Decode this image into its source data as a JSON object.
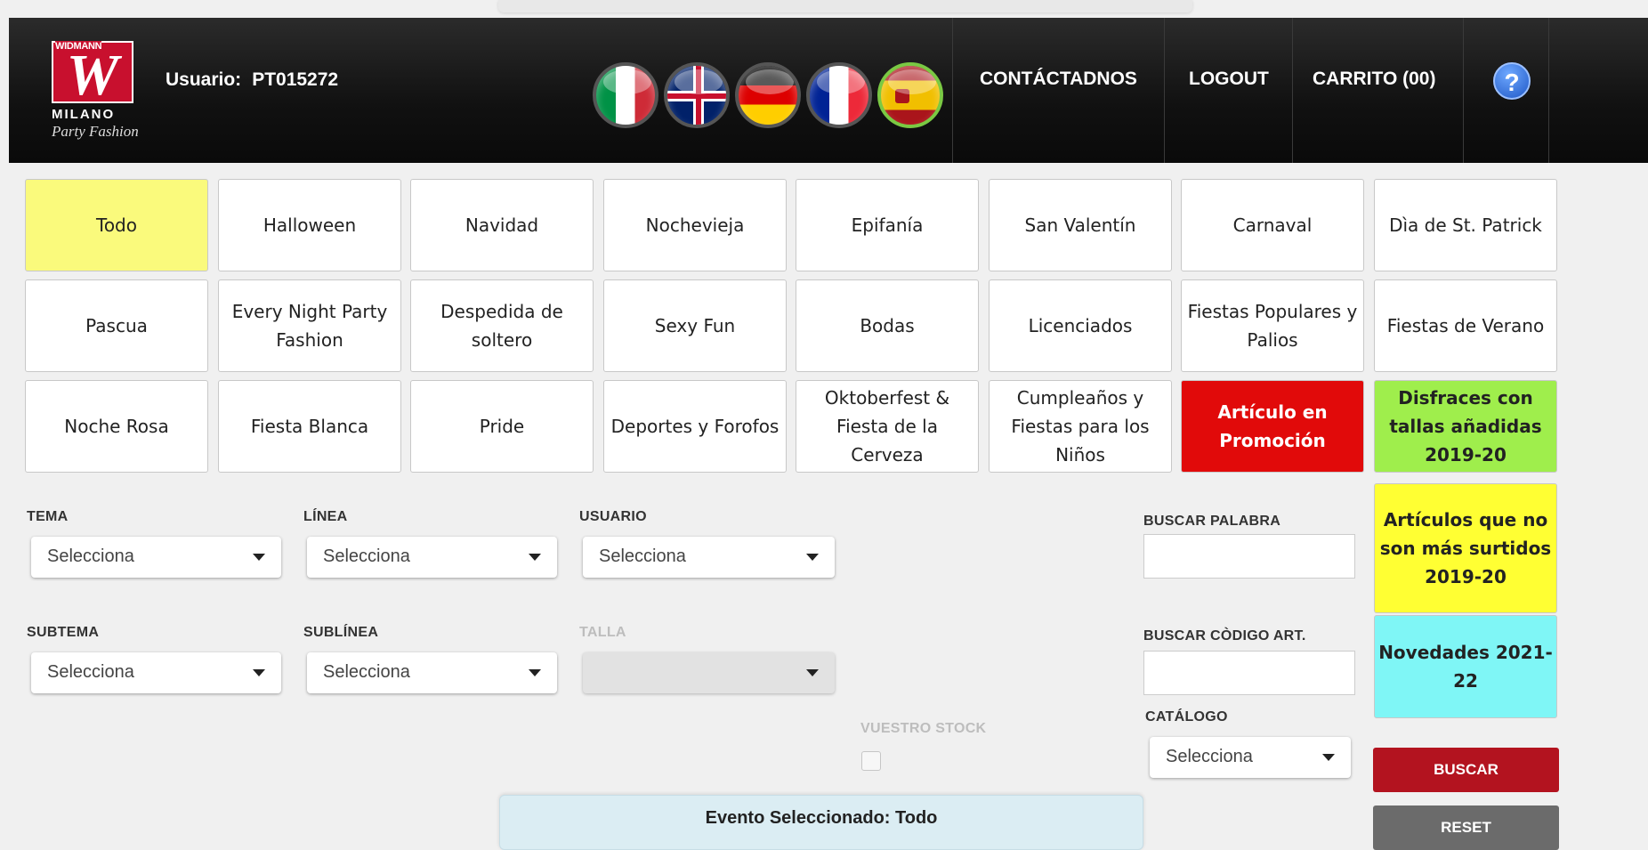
{
  "header": {
    "brand": {
      "top": "WIDMANN",
      "mark": "W",
      "city": "MILANO",
      "tagline": "Party Fashion"
    },
    "user_label": "Usuario:",
    "user_value": "PT015272",
    "flags": [
      "flag-italy-icon",
      "flag-uk-icon",
      "flag-germany-icon",
      "flag-france-icon",
      "flag-spain-icon"
    ],
    "active_language": "es",
    "nav": {
      "contact": "CONTÁCTADNOS",
      "logout": "LOGOUT",
      "cart": "CARRITO (00)"
    },
    "help_icon": "?"
  },
  "events": [
    "Todo",
    "Halloween",
    "Navidad",
    "Nochevieja",
    "Epifanía",
    "San Valentín",
    "Carnaval",
    "Dìa de St. Patrick",
    "Pascua",
    "Every Night Party Fashion",
    "Despedida de soltero",
    "Sexy Fun",
    "Bodas",
    "Licenciados",
    "Fiestas Populares y Palios",
    "Fiestas de Verano",
    "Noche Rosa",
    "Fiesta Blanca",
    "Pride",
    "Deportes y Forofos",
    "Oktoberfest & Fiesta de la Cerveza",
    "Cumpleaños y Fiestas para los Niños",
    "Artículo en Promoción",
    "Disfraces con tallas añadidas 2019-20"
  ],
  "side_buttons": {
    "no_stock": "Artículos que no son más surtidos 2019-20",
    "new": "Novedades 2021-22"
  },
  "filters": {
    "tema": {
      "label": "TEMA",
      "value": "Selecciona"
    },
    "linea": {
      "label": "LÍNEA",
      "value": "Selecciona"
    },
    "usuario": {
      "label": "USUARIO",
      "value": "Selecciona"
    },
    "subtema": {
      "label": "SUBTEMA",
      "value": "Selecciona"
    },
    "sublinea": {
      "label": "SUBLÍNEA",
      "value": "Selecciona"
    },
    "talla": {
      "label": "TALLA",
      "value": ""
    },
    "stock": {
      "label": "VUESTRO STOCK",
      "checked": false
    },
    "buscar_palabra": {
      "label": "BUSCAR PALABRA",
      "value": ""
    },
    "buscar_codigo": {
      "label": "BUSCAR CÒDIGO ART.",
      "value": ""
    },
    "catalogo": {
      "label": "CATÁLOGO",
      "value": "Selecciona"
    }
  },
  "actions": {
    "search": "BUSCAR",
    "reset": "RESET"
  },
  "selected_event": "Evento Seleccionado: Todo",
  "colors": {
    "selected": "#fafa7c",
    "promo": "#e10a0a",
    "green": "#9fee4c",
    "yellow": "#ffff33",
    "cyan": "#7ff6f6",
    "search": "#b3131f"
  }
}
